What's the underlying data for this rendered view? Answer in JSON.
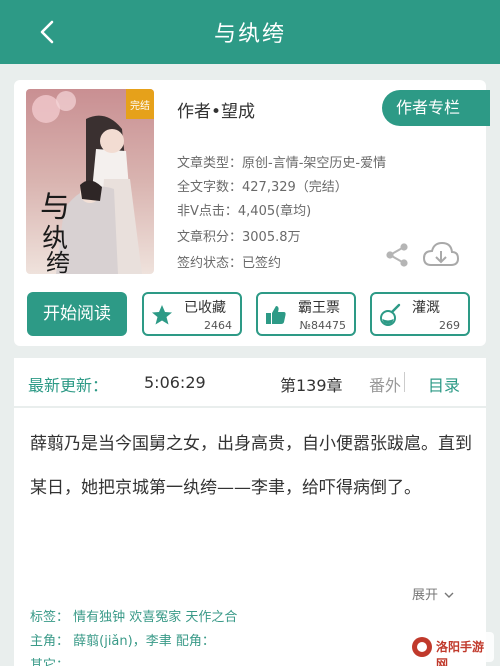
{
  "header": {
    "title": "与纨绔"
  },
  "book": {
    "author": "作者•望成",
    "author_column": "作者专栏",
    "cover_alt": "与纨绔",
    "cover_badge": "完结",
    "info": [
      "文章类型：原创-言情-架空历史-爱情",
      "全文字数：427,329（完结）",
      "非V点击：4,405(章均)",
      "文章积分：3005.8万",
      "签约状态：已签约"
    ]
  },
  "actions": {
    "read": "开始阅读",
    "favorite": {
      "label": "已收藏",
      "count": "2464"
    },
    "ticket": {
      "label": "霸王票",
      "count": "№84475"
    },
    "nutrient": {
      "label": "灌溉",
      "count": "269"
    }
  },
  "update": {
    "label": "最新更新：",
    "time": "5:06:29",
    "chapter": "第139章",
    "chapter_title": "番外",
    "toc": "目录"
  },
  "synopsis": {
    "text": "薛翦乃是当今国舅之女，出身高贵，自小便嚣张跋扈。直到某日，她把京城第一纨绔——李聿，给吓得病倒了。",
    "expand": "展开",
    "tags": "标签： 情有独钟  欢喜冤家  天作之合",
    "roles": "主角： 薛翦(jiǎn)，李聿        配角：",
    "other": "其它："
  },
  "watermark": {
    "text": "洛阳手游网"
  },
  "colors": {
    "accent": "#2d9a86",
    "background": "#e9eeed"
  }
}
